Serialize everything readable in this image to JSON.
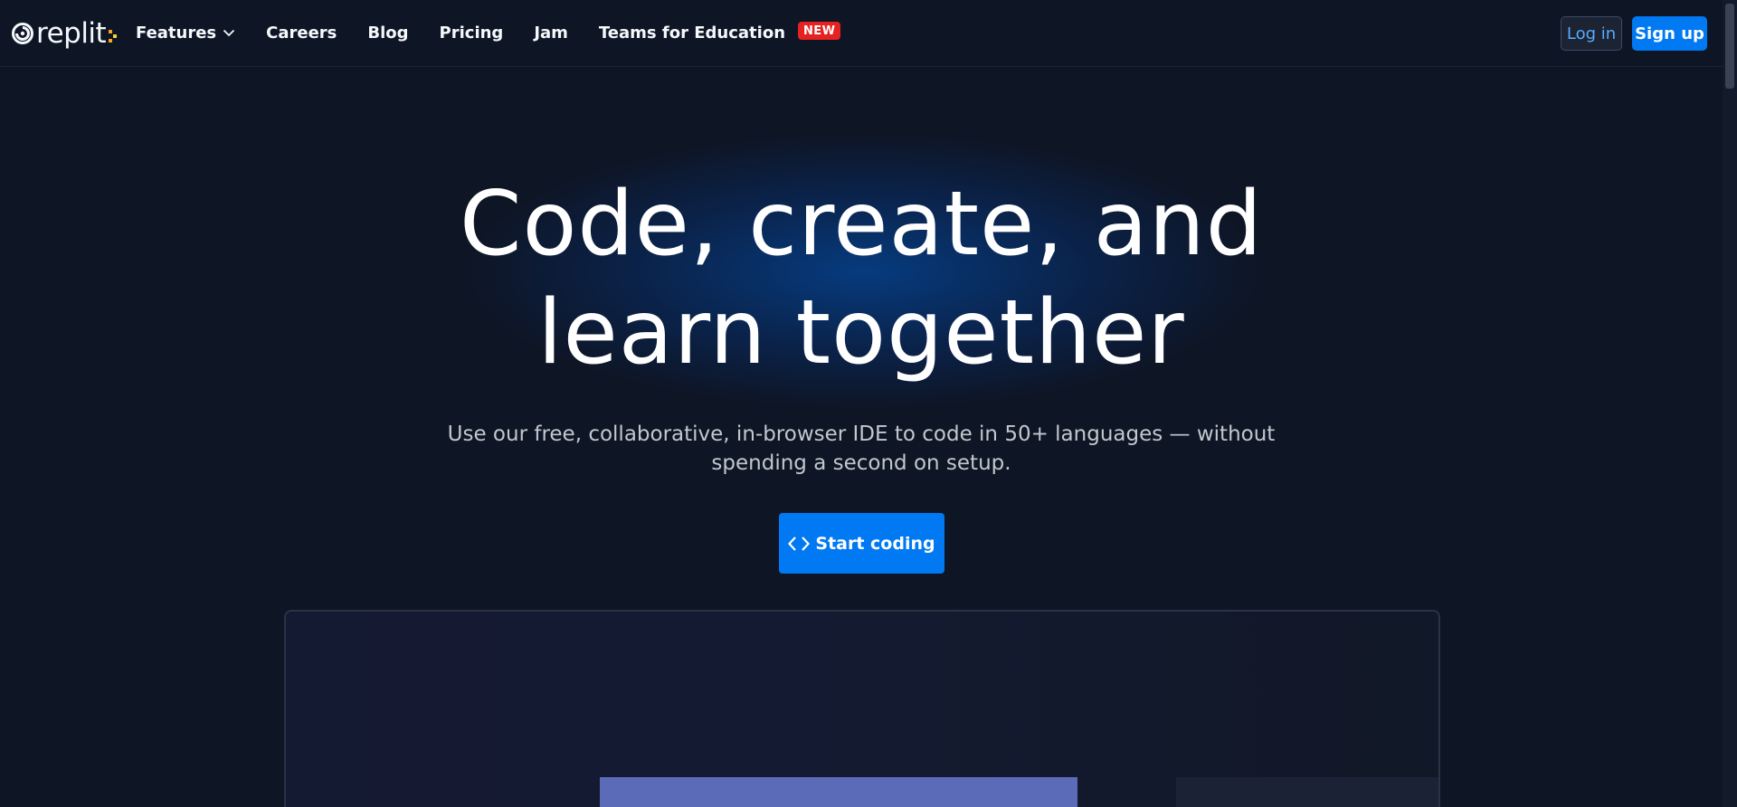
{
  "brand": {
    "name": "replit"
  },
  "nav": {
    "items": [
      {
        "label": "Features",
        "has_dropdown": true
      },
      {
        "label": "Careers"
      },
      {
        "label": "Blog"
      },
      {
        "label": "Pricing"
      },
      {
        "label": "Jam"
      },
      {
        "label": "Teams for Education",
        "badge": "NEW"
      }
    ]
  },
  "auth": {
    "login_label": "Log in",
    "signup_label": "Sign up"
  },
  "hero": {
    "title_line1": "Code, create, and",
    "title_line2": "learn together",
    "subtitle_line1": "Use our free, collaborative, in-browser IDE to code in 50+ languages — without",
    "subtitle_line2": "spending a second on setup.",
    "cta_label": "Start coding"
  },
  "colors": {
    "background": "#0e1525",
    "primary": "#0079f2",
    "badge": "#e52222",
    "login_text": "#57abff"
  },
  "icons": {
    "logo": "replit-logo-icon",
    "dropdown": "chevron-down-icon",
    "cta": "code-brackets-icon"
  }
}
